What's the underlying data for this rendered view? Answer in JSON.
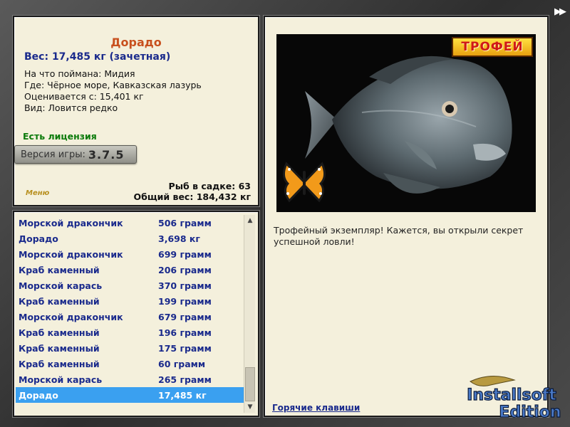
{
  "info": {
    "fish_name": "Дорадо",
    "weight_line": "Вес: 17,485 кг (зачетная)",
    "caught_on": "На что поймана: Мидия",
    "location": "Где: Чёрное море, Кавказская лазурь",
    "rated_from": "Оценивается с: 15,401 кг",
    "kind": "Вид: Ловится редко",
    "license": "Есть лицензия",
    "version_label": "Версия игры:",
    "version_number": "3.7.5",
    "menu_label": "Меню",
    "fish_in_keepnet": "Рыб в садке: 63",
    "total_weight": "Общий вес: 184,432 кг"
  },
  "catch_list": [
    {
      "name": "Морской дракончик",
      "weight": "506 грамм"
    },
    {
      "name": "Дорадо",
      "weight": "3,698 кг"
    },
    {
      "name": "Морской дракончик",
      "weight": "699 грамм"
    },
    {
      "name": "Краб каменный",
      "weight": "206 грамм"
    },
    {
      "name": "Морской карась",
      "weight": "370 грамм"
    },
    {
      "name": "Краб каменный",
      "weight": "199 грамм"
    },
    {
      "name": "Морской дракончик",
      "weight": "679 грамм"
    },
    {
      "name": "Краб каменный",
      "weight": "196 грамм"
    },
    {
      "name": "Краб каменный",
      "weight": "175 грамм"
    },
    {
      "name": "Краб каменный",
      "weight": "60 грамм"
    },
    {
      "name": "Морской карась",
      "weight": "265 грамм"
    },
    {
      "name": "Дорадо",
      "weight": "17,485 кг"
    }
  ],
  "selected_index": 11,
  "right": {
    "trophy_badge": "ТРОФЕЙ",
    "trophy_message": "Трофейный экземпляр! Кажется, вы открыли секрет успешной ловли!",
    "hotkeys_link": "Горячие клавиши"
  },
  "watermark": {
    "line1": "Installsoft",
    "line2": "Edition"
  },
  "icons": {
    "fast_forward": "fast-forward-icon",
    "scroll_up": "chevron-up-icon",
    "scroll_down": "chevron-down-icon"
  },
  "colors": {
    "title": "#c8501e",
    "accent_blue": "#1a2a8c",
    "license_green": "#0a7a0a",
    "selection": "#3aa0f0",
    "panel_bg": "#f4f0dc"
  }
}
